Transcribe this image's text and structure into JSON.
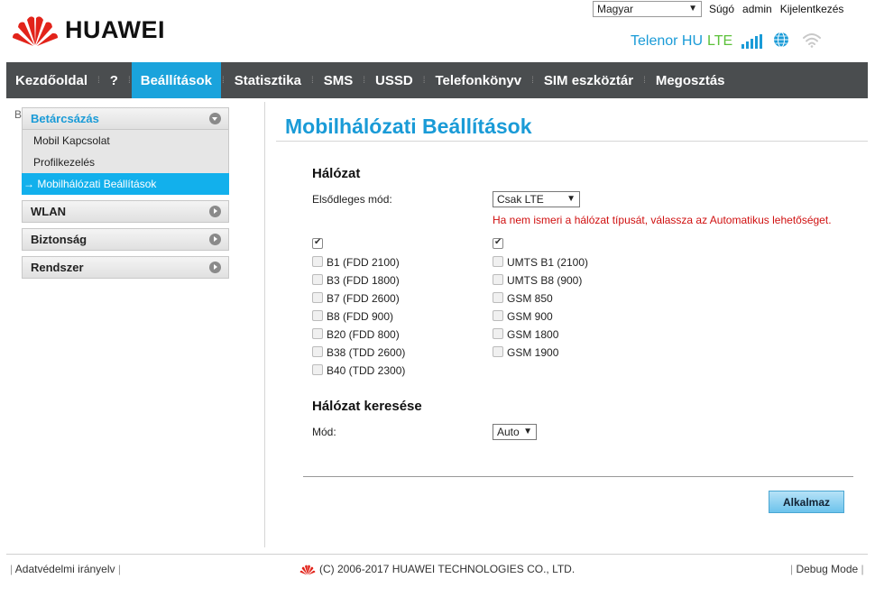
{
  "header": {
    "brand": "HUAWEI",
    "language": "Magyar",
    "links": {
      "help": "Súgó",
      "admin": "admin",
      "logout": "Kijelentkezés"
    },
    "operator": "Telenor HU",
    "network_type": "LTE",
    "colors": {
      "accent": "#1a9bd7",
      "lte": "#5cc13a",
      "nav_bg": "#4a4d4f",
      "active_bg": "#1aa3dc"
    }
  },
  "nav": {
    "items": [
      "Kezdőoldal",
      "?",
      "Beállítások",
      "Statisztika",
      "SMS",
      "USSD",
      "Telefonkönyv",
      "SIM eszköztár",
      "Megosztás"
    ],
    "active_index": 2
  },
  "sidebar": {
    "cut_text": "B",
    "group_dialup": "Betárcsázás",
    "sub_items": [
      "Mobil Kapcsolat",
      "Profilkezelés",
      "Mobilhálózati Beállítások"
    ],
    "active_sub": "→ Mobilhálózati Beállítások",
    "groups": [
      "WLAN",
      "Biztonság",
      "Rendszer"
    ]
  },
  "main": {
    "title": "Mobilhálózati Beállítások",
    "network_section": "Hálózat",
    "preferred_mode_label": "Elsődleges mód:",
    "preferred_mode_value": "Csak LTE",
    "warning": "Ha nem ismeri a hálózat típusát, válassza az Automatikus lehetőséget.",
    "lte_bands": [
      "B1 (FDD 2100)",
      "B3 (FDD 1800)",
      "B7 (FDD 2600)",
      "B8 (FDD 900)",
      "B20 (FDD 800)",
      "B38 (TDD 2600)",
      "B40 (TDD 2300)"
    ],
    "other_bands": [
      "UMTS B1 (2100)",
      "UMTS B8 (900)",
      "GSM 850",
      "GSM 900",
      "GSM 1800",
      "GSM 1900"
    ],
    "search_section": "Hálózat keresése",
    "mode_label": "Mód:",
    "mode_value": "Auto",
    "apply_label": "Alkalmaz"
  },
  "footer": {
    "privacy": "Adatvédelmi irányelv",
    "copyright": "(C) 2006-2017 HUAWEI TECHNOLOGIES CO., LTD.",
    "debug": "Debug Mode"
  }
}
